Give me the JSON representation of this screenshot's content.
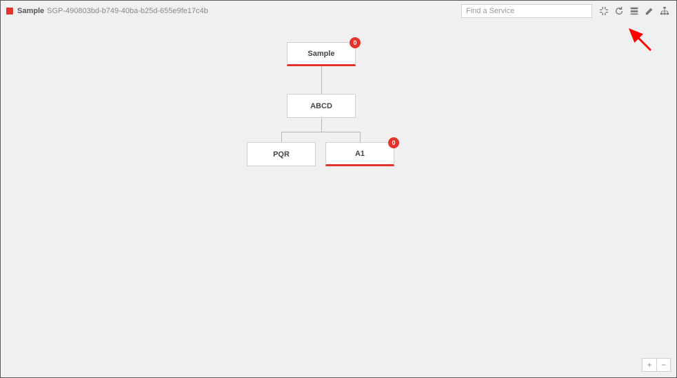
{
  "header": {
    "title": "Sample",
    "id": "SGP-490803bd-b749-40ba-b25d-655e9fe17c4b"
  },
  "search": {
    "placeholder": "Find a Service"
  },
  "toolbar": {
    "collapse": "collapse",
    "refresh": "refresh",
    "layout": "layout",
    "edit": "edit",
    "tree": "tree"
  },
  "nodes": {
    "root": {
      "label": "Sample",
      "badge": "0"
    },
    "child1": {
      "label": "ABCD"
    },
    "leaf1": {
      "label": "PQR"
    },
    "leaf2": {
      "label": "A1",
      "badge": "0"
    }
  },
  "zoom": {
    "plus": "+",
    "minus": "−"
  }
}
